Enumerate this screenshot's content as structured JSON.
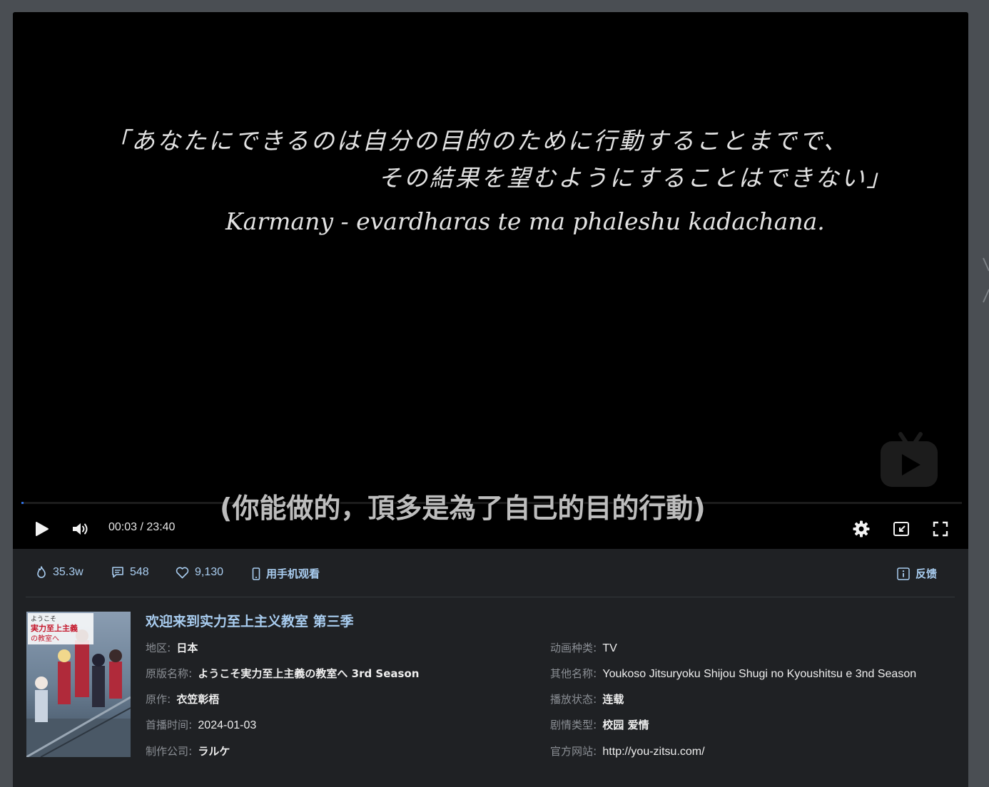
{
  "player": {
    "overlay_text": {
      "jp_line1": "「あなたにできるのは自分の目的のために行動することまでで、",
      "jp_line2": "その結果を望むようにすることはできない」",
      "en_line": "Karmany - evardharas te ma phaleshu kadachana."
    },
    "subtitle": "(你能做的，頂多是為了自己的目的行動)",
    "time_current": "00:03",
    "time_separator": " / ",
    "time_total": "23:40",
    "progress_fraction": 0.002,
    "accent_color": "#2f6fde",
    "icons": [
      "play-icon",
      "volume-icon",
      "settings-icon",
      "picture-in-picture-icon",
      "fullscreen-icon",
      "bilibili-watermark-icon"
    ]
  },
  "stats": {
    "views": "35.3w",
    "comments": "548",
    "likes": "9,130",
    "mobile_label": "用手机观看",
    "feedback_label": "反馈"
  },
  "anime": {
    "title": "欢迎来到实力至上主义教室 第三季",
    "poster_text": {
      "line1": "ようこそ",
      "line2": "実力至上主義",
      "line3": "の教室へ"
    },
    "fields": {
      "region": {
        "label": "地区",
        "value": "日本"
      },
      "type": {
        "label": "动画种类",
        "value": "TV"
      },
      "original_name": {
        "label": "原版名称",
        "value": "ようこそ実力至上主義の教室へ 3rd Season"
      },
      "other_name": {
        "label": "其他名称",
        "value": "Youkoso Jitsuryoku Shijou Shugi no Kyoushitsu e 3nd Season"
      },
      "author": {
        "label": "原作",
        "value": "衣笠彰梧"
      },
      "status": {
        "label": "播放状态",
        "value": "连载"
      },
      "premiere": {
        "label": "首播时间",
        "value": "2024-01-03"
      },
      "genre": {
        "label": "剧情类型",
        "value": "校园 爱情"
      },
      "studio": {
        "label": "制作公司",
        "value": "ラルケ"
      },
      "website": {
        "label": "官方网站",
        "value": "http://you-zitsu.com/"
      }
    }
  },
  "colors": {
    "page_bg": "#4a4e53",
    "panel_bg": "#1f2124",
    "link_blue": "#a9cdf0",
    "label_gray": "#8b8f95"
  }
}
